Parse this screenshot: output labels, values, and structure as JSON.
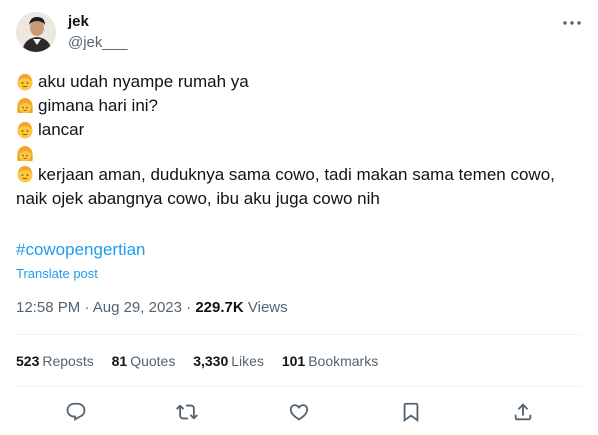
{
  "author": {
    "name": "jek",
    "handle": "@jek___"
  },
  "post": {
    "lines": [
      {
        "emoji": "person-face-emoji",
        "text": "aku udah nyampe rumah ya"
      },
      {
        "emoji": "woman-face-emoji",
        "text": "gimana hari ini?"
      },
      {
        "emoji": "person-face-emoji",
        "text": "lancar"
      },
      {
        "emoji": "woman-face-emoji",
        "text": ""
      },
      {
        "emoji": "person-face-emoji",
        "text": "kerjaan aman, duduknya sama cowo, tadi makan sama temen cowo, naik ojek abangnya cowo, ibu aku juga cowo nih"
      }
    ],
    "hashtag": "#cowopengertian",
    "translate_label": "Translate post"
  },
  "meta": {
    "time": "12:58 PM",
    "separator": "·",
    "date": "Aug 29, 2023",
    "views_count": "229.7K",
    "views_label": "Views"
  },
  "stats": {
    "reposts": {
      "count": "523",
      "label": "Reposts"
    },
    "quotes": {
      "count": "81",
      "label": "Quotes"
    },
    "likes": {
      "count": "3,330",
      "label": "Likes"
    },
    "bookmarks": {
      "count": "101",
      "label": "Bookmarks"
    }
  },
  "actions": [
    "reply-icon",
    "repost-icon",
    "like-icon",
    "bookmark-icon",
    "share-icon"
  ],
  "colors": {
    "link": "#1d9bf0",
    "secondary": "#536471",
    "primary": "#0f1419",
    "divider": "#eff3f4"
  }
}
